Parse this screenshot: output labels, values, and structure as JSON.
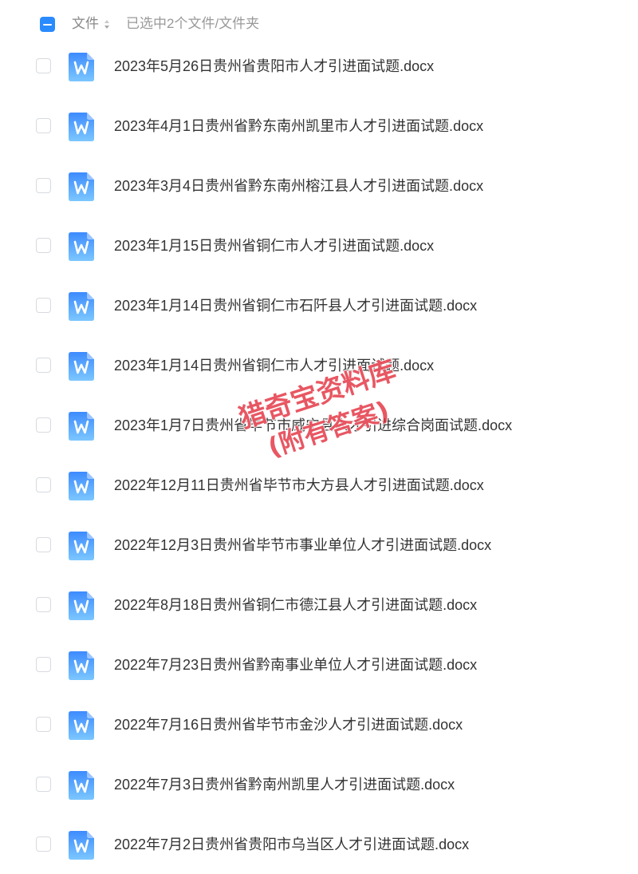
{
  "header": {
    "column_label": "文件",
    "selected_info": "已选中2个文件/文件夹"
  },
  "files": [
    {
      "name": "2023年5月26日贵州省贵阳市人才引进面试题.docx",
      "icon": "word-doc-icon"
    },
    {
      "name": "2023年4月1日贵州省黔东南州凯里市人才引进面试题.docx",
      "icon": "word-doc-icon"
    },
    {
      "name": "2023年3月4日贵州省黔东南州榕江县人才引进面试题.docx",
      "icon": "word-doc-icon"
    },
    {
      "name": "2023年1月15日贵州省铜仁市人才引进面试题.docx",
      "icon": "word-doc-icon"
    },
    {
      "name": "2023年1月14日贵州省铜仁市石阡县人才引进面试题.docx",
      "icon": "word-doc-icon"
    },
    {
      "name": "2023年1月14日贵州省铜仁市人才引进面试题.docx",
      "icon": "word-doc-icon"
    },
    {
      "name": "2023年1月7日贵州省毕节市威宁县人才引进综合岗面试题.docx",
      "icon": "word-doc-icon"
    },
    {
      "name": "2022年12月11日贵州省毕节市大方县人才引进面试题.docx",
      "icon": "word-doc-icon"
    },
    {
      "name": "2022年12月3日贵州省毕节市事业单位人才引进面试题.docx",
      "icon": "word-doc-icon"
    },
    {
      "name": "2022年8月18日贵州省铜仁市德江县人才引进面试题.docx",
      "icon": "word-doc-icon"
    },
    {
      "name": "2022年7月23日贵州省黔南事业单位人才引进面试题.docx",
      "icon": "word-doc-icon"
    },
    {
      "name": "2022年7月16日贵州省毕节市金沙人才引进面试题.docx",
      "icon": "word-doc-icon"
    },
    {
      "name": "2022年7月3日贵州省黔南州凯里人才引进面试题.docx",
      "icon": "word-doc-icon"
    },
    {
      "name": "2022年7月2日贵州省贵阳市乌当区人才引进面试题.docx",
      "icon": "word-doc-icon"
    }
  ],
  "watermark": {
    "line1": "猎奇宝资料库",
    "line2": "(附有答案)"
  },
  "colors": {
    "accent": "#2a8bff",
    "icon_gradient_top": "#3d8bff",
    "icon_gradient_bottom": "#7cc7ff",
    "watermark": "#e22837"
  }
}
